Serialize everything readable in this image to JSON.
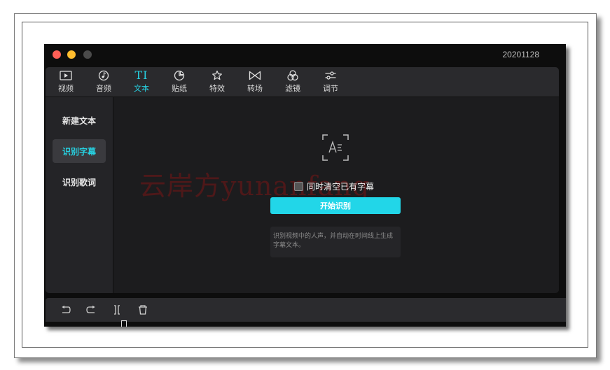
{
  "window": {
    "title": "20201128"
  },
  "toolbar": {
    "items": [
      {
        "label": "视频",
        "icon": "video-icon"
      },
      {
        "label": "音频",
        "icon": "audio-icon"
      },
      {
        "label": "文本",
        "icon": "text-icon",
        "glyph": "TI"
      },
      {
        "label": "贴纸",
        "icon": "sticker-icon"
      },
      {
        "label": "特效",
        "icon": "effects-icon"
      },
      {
        "label": "转场",
        "icon": "transition-icon"
      },
      {
        "label": "滤镜",
        "icon": "filter-icon"
      },
      {
        "label": "调节",
        "icon": "adjust-icon"
      }
    ],
    "active_index": 2
  },
  "sidebar": {
    "items": [
      {
        "label": "新建文本"
      },
      {
        "label": "识别字幕"
      },
      {
        "label": "识别歌词"
      }
    ],
    "active_index": 1
  },
  "main": {
    "watermark": "云岸方yunanfang",
    "checkbox_label": "同时清空已有字幕",
    "checkbox_checked": false,
    "start_button": "开始识别",
    "description": "识别视频中的人声，并自动在时间线上生成字幕文本。"
  },
  "bottom_toolbar": {
    "icons": [
      "undo-icon",
      "redo-icon",
      "split-icon",
      "delete-icon"
    ]
  },
  "colors": {
    "accent": "#22d6e8",
    "window_bg": "#0d0d0d",
    "panel_bg": "#1b1b1d"
  }
}
